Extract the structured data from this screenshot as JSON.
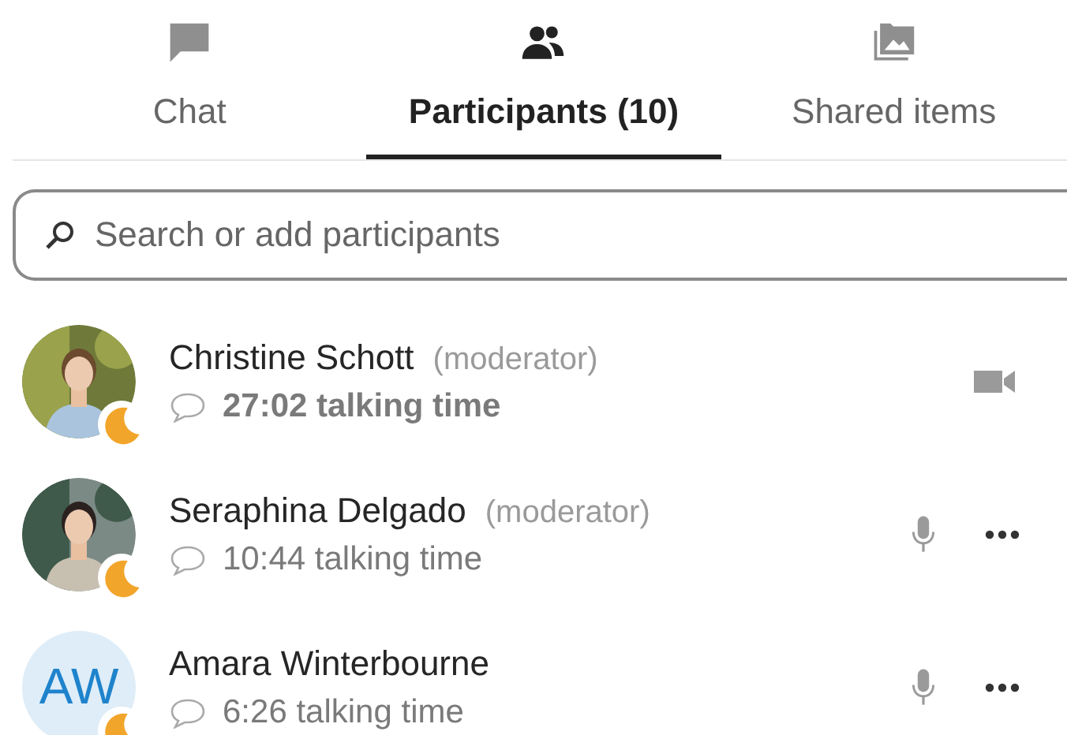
{
  "tabs": [
    {
      "label": "Chat",
      "selected": false
    },
    {
      "label": "Participants (10)",
      "selected": true
    },
    {
      "label": "Shared items",
      "selected": false
    }
  ],
  "search": {
    "placeholder": "Search or add participants"
  },
  "participants": [
    {
      "name": "Christine Schott",
      "role": "(moderator)",
      "talking_time": "27:02 talking time",
      "speaking": true,
      "avatar": {
        "kind": "picture"
      },
      "actions": [
        {
          "kind": "video"
        }
      ]
    },
    {
      "name": "Seraphina Delgado",
      "role": "(moderator)",
      "talking_time": "10:44 talking time",
      "speaking": false,
      "avatar": {
        "kind": "picture"
      },
      "actions": [
        {
          "kind": "mic"
        },
        {
          "kind": "more"
        }
      ]
    },
    {
      "name": "Amara Winterbourne",
      "talking_time": "6:26 talking time",
      "speaking": false,
      "avatar": {
        "kind": "initials",
        "initials": "AW"
      },
      "actions": [
        {
          "kind": "mic"
        },
        {
          "kind": "more"
        }
      ]
    }
  ]
}
